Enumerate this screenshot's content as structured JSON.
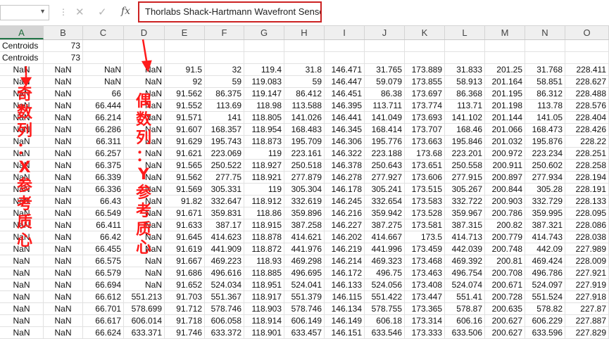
{
  "formula_bar": {
    "name_box_value": "",
    "cancel_icon": "x-icon",
    "enter_icon": "check-icon",
    "fx_label": "fx",
    "formula_text": "Thorlabs Shack-Hartmann Wavefront Sensor"
  },
  "columns": [
    "A",
    "B",
    "C",
    "D",
    "E",
    "F",
    "G",
    "H",
    "I",
    "J",
    "K",
    "L",
    "M",
    "N",
    "O"
  ],
  "selected_column": "A",
  "rows": [
    [
      "Centroids",
      "73",
      "",
      "",
      "",
      "",
      "",
      "",
      "",
      "",
      "",
      "",
      "",
      "",
      ""
    ],
    [
      "Centroids",
      "73",
      "",
      "",
      "",
      "",
      "",
      "",
      "",
      "",
      "",
      "",
      "",
      "",
      ""
    ],
    [
      "NaN",
      "NaN",
      "NaN",
      "NaN",
      "91.5",
      "32",
      "119.4",
      "31.8",
      "146.471",
      "31.765",
      "173.889",
      "31.833",
      "201.25",
      "31.768",
      "228.411"
    ],
    [
      "NaN",
      "NaN",
      "NaN",
      "NaN",
      "92",
      "59",
      "119.083",
      "59",
      "146.447",
      "59.079",
      "173.855",
      "58.913",
      "201.164",
      "58.851",
      "228.627"
    ],
    [
      "NaN",
      "NaN",
      "66",
      "NaN",
      "91.562",
      "86.375",
      "119.147",
      "86.412",
      "146.451",
      "86.38",
      "173.697",
      "86.368",
      "201.195",
      "86.312",
      "228.488"
    ],
    [
      "NaN",
      "NaN",
      "66.444",
      "NaN",
      "91.552",
      "113.69",
      "118.98",
      "113.588",
      "146.395",
      "113.711",
      "173.774",
      "113.71",
      "201.198",
      "113.78",
      "228.576"
    ],
    [
      "NaN",
      "NaN",
      "66.214",
      "NaN",
      "91.571",
      "141",
      "118.805",
      "141.026",
      "146.441",
      "141.049",
      "173.693",
      "141.102",
      "201.144",
      "141.05",
      "228.404"
    ],
    [
      "NaN",
      "NaN",
      "66.286",
      "NaN",
      "91.607",
      "168.357",
      "118.954",
      "168.483",
      "146.345",
      "168.414",
      "173.707",
      "168.46",
      "201.066",
      "168.473",
      "228.426"
    ],
    [
      "NaN",
      "NaN",
      "66.311",
      "NaN",
      "91.629",
      "195.743",
      "118.873",
      "195.709",
      "146.306",
      "195.776",
      "173.663",
      "195.846",
      "201.032",
      "195.876",
      "228.22"
    ],
    [
      "NaN",
      "NaN",
      "66.257",
      "NaN",
      "91.621",
      "223.069",
      "119",
      "223.161",
      "146.322",
      "223.188",
      "173.68",
      "223.201",
      "200.972",
      "223.234",
      "228.251"
    ],
    [
      "NaN",
      "NaN",
      "66.375",
      "NaN",
      "91.565",
      "250.522",
      "118.927",
      "250.518",
      "146.378",
      "250.643",
      "173.651",
      "250.558",
      "200.911",
      "250.602",
      "228.258"
    ],
    [
      "NaN",
      "NaN",
      "66.339",
      "NaN",
      "91.562",
      "277.75",
      "118.921",
      "277.879",
      "146.278",
      "277.927",
      "173.606",
      "277.915",
      "200.897",
      "277.934",
      "228.194"
    ],
    [
      "NaN",
      "NaN",
      "66.336",
      "NaN",
      "91.569",
      "305.331",
      "119",
      "305.304",
      "146.178",
      "305.241",
      "173.515",
      "305.267",
      "200.844",
      "305.28",
      "228.191"
    ],
    [
      "NaN",
      "NaN",
      "66.43",
      "NaN",
      "91.82",
      "332.647",
      "118.912",
      "332.619",
      "146.245",
      "332.654",
      "173.583",
      "332.722",
      "200.903",
      "332.729",
      "228.133"
    ],
    [
      "NaN",
      "NaN",
      "66.549",
      "NaN",
      "91.671",
      "359.831",
      "118.86",
      "359.896",
      "146.216",
      "359.942",
      "173.528",
      "359.967",
      "200.786",
      "359.995",
      "228.095"
    ],
    [
      "NaN",
      "NaN",
      "66.411",
      "NaN",
      "91.633",
      "387.17",
      "118.915",
      "387.258",
      "146.227",
      "387.275",
      "173.581",
      "387.315",
      "200.82",
      "387.321",
      "228.086"
    ],
    [
      "NaN",
      "NaN",
      "66.42",
      "NaN",
      "91.645",
      "414.623",
      "118.878",
      "414.621",
      "146.202",
      "414.667",
      "173.5",
      "414.713",
      "200.779",
      "414.743",
      "228.038"
    ],
    [
      "NaN",
      "NaN",
      "66.455",
      "NaN",
      "91.619",
      "441.909",
      "118.872",
      "441.976",
      "146.219",
      "441.996",
      "173.459",
      "442.039",
      "200.748",
      "442.09",
      "227.989"
    ],
    [
      "NaN",
      "NaN",
      "66.575",
      "NaN",
      "91.667",
      "469.223",
      "118.93",
      "469.298",
      "146.214",
      "469.323",
      "173.468",
      "469.392",
      "200.81",
      "469.424",
      "228.009"
    ],
    [
      "NaN",
      "NaN",
      "66.579",
      "NaN",
      "91.686",
      "496.616",
      "118.885",
      "496.695",
      "146.172",
      "496.75",
      "173.463",
      "496.754",
      "200.708",
      "496.786",
      "227.921"
    ],
    [
      "NaN",
      "NaN",
      "66.694",
      "NaN",
      "91.652",
      "524.034",
      "118.951",
      "524.041",
      "146.133",
      "524.056",
      "173.408",
      "524.074",
      "200.671",
      "524.097",
      "227.919"
    ],
    [
      "NaN",
      "NaN",
      "66.612",
      "551.213",
      "91.703",
      "551.367",
      "118.917",
      "551.379",
      "146.115",
      "551.422",
      "173.447",
      "551.41",
      "200.728",
      "551.524",
      "227.918"
    ],
    [
      "NaN",
      "NaN",
      "66.701",
      "578.699",
      "91.712",
      "578.746",
      "118.903",
      "578.746",
      "146.134",
      "578.755",
      "173.365",
      "578.87",
      "200.635",
      "578.82",
      "227.87"
    ],
    [
      "NaN",
      "NaN",
      "66.617",
      "606.014",
      "91.718",
      "606.058",
      "118.914",
      "606.149",
      "146.149",
      "606.18",
      "173.314",
      "606.16",
      "200.627",
      "606.229",
      "227.887"
    ],
    [
      "NaN",
      "NaN",
      "66.624",
      "633.371",
      "91.746",
      "633.372",
      "118.901",
      "633.457",
      "146.151",
      "633.546",
      "173.333",
      "633.506",
      "200.627",
      "633.596",
      "227.829"
    ]
  ],
  "annotations": {
    "left_text": [
      "奇",
      "数",
      "列",
      "：",
      "X",
      "参",
      "考",
      "质",
      "心"
    ],
    "middle_text": [
      "偶",
      "数",
      "列",
      "：",
      "Y",
      "参",
      "考",
      "质",
      "心"
    ],
    "color": "#ff1a1a"
  },
  "colors": {
    "highlight_border": "#cc2222",
    "selected_header": "#217346"
  }
}
